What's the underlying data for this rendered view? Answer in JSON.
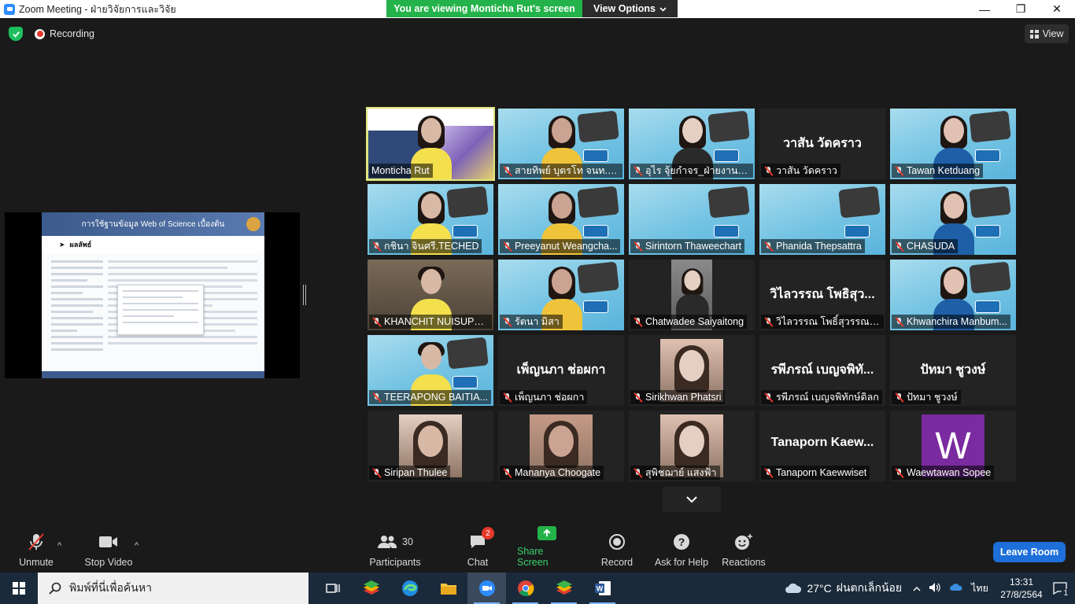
{
  "window": {
    "title": "Zoom Meeting - ฝ่ายวิจัยการและวิจัย",
    "minimize": "—",
    "maximize": "❐",
    "close": "✕"
  },
  "banner": {
    "viewing": "You are viewing Monticha Rut's screen",
    "view_options": "View Options",
    "chevron": "⌄"
  },
  "status": {
    "recording": "Recording",
    "view": "View"
  },
  "slide": {
    "header": "การใช้ฐานข้อมูล Web of Science เบื้องต้น",
    "subtitle": "ผลลัพธ์"
  },
  "participants": [
    {
      "name": "Monticha Rut",
      "display": "",
      "kind": "photo-rutt"
    },
    {
      "name": "สายทิพย์  บุตรโท  จนท.ปร...",
      "display": "",
      "kind": "ppt"
    },
    {
      "name": "อุไร จุ้ยกำจร_ฝ่ายงานประ...",
      "display": "",
      "kind": "ppt"
    },
    {
      "name": "วาสัน  วัดคราว",
      "display": "วาสัน  วัดคราว",
      "kind": "name"
    },
    {
      "name": "Tawan Ketduang",
      "display": "",
      "kind": "ppt"
    },
    {
      "name": "กชินา  จินศรี.TECHED",
      "display": "",
      "kind": "ppt"
    },
    {
      "name": "Preeyanut Weangcha...",
      "display": "",
      "kind": "ppt"
    },
    {
      "name": "Sirintorn Thaweechart",
      "display": "",
      "kind": "ppt-empty"
    },
    {
      "name": "Phanida Thepsattra",
      "display": "",
      "kind": "ppt-empty"
    },
    {
      "name": "CHASUDA",
      "display": "",
      "kind": "ppt"
    },
    {
      "name": "KHANCHIT NUISUPHAP",
      "display": "",
      "kind": "cam-man"
    },
    {
      "name": "รัตนา  มิสา",
      "display": "",
      "kind": "ppt"
    },
    {
      "name": "Chatwadee Saiyaitong",
      "display": "",
      "kind": "cam-portrait"
    },
    {
      "name": "วิไลวรรณ  โพธิ์สุวรรณพร",
      "display": "วิไลวรรณ  โพธิสุว...",
      "kind": "name"
    },
    {
      "name": "Khwanchira Manbum...",
      "display": "",
      "kind": "ppt"
    },
    {
      "name": "TEERAPONG  BAITIA...",
      "display": "",
      "kind": "ppt-man"
    },
    {
      "name": "เพ็ญนภา  ช่อผกา",
      "display": "เพ็ญนภา  ช่อผกา",
      "kind": "name"
    },
    {
      "name": "Sirikhwan Phatsri",
      "display": "",
      "kind": "photo"
    },
    {
      "name": "รพีภรณ์  เบญจพิทักษ์ดิลก",
      "display": "รพีภรณ์  เบญจพิทั...",
      "kind": "name"
    },
    {
      "name": "ปัทมา  ชูวงษ์",
      "display": "ปัทมา  ชูวงษ์",
      "kind": "name"
    },
    {
      "name": "Siripan Thulee",
      "display": "",
      "kind": "photo"
    },
    {
      "name": "Mananya Choogate",
      "display": "",
      "kind": "photo"
    },
    {
      "name": "สุพิชฌาย์ แสงฟ้า",
      "display": "",
      "kind": "photo"
    },
    {
      "name": "Tanaporn Kaewwiset",
      "display": "Tanaporn  Kaew...",
      "kind": "name"
    },
    {
      "name": "Waewtawan Sopee",
      "display": "",
      "kind": "letter",
      "letter": "W"
    }
  ],
  "toolbar": {
    "unmute": "Unmute",
    "stop_video": "Stop Video",
    "participants": "Participants",
    "participants_count": "30",
    "chat": "Chat",
    "chat_badge": "2",
    "share_screen": "Share Screen",
    "record": "Record",
    "ask_help": "Ask for Help",
    "reactions": "Reactions",
    "leave": "Leave Room",
    "caret": "^"
  },
  "taskbar": {
    "search_placeholder": "พิมพ์ที่นี่เพื่อค้นหา",
    "temperature": "27°C",
    "weather": "ฝนตกเล็กน้อย",
    "language": "ไทย",
    "time": "13:31",
    "date": "27/8/2564",
    "notifications": "1"
  },
  "colors": {
    "accent_green": "#24b34a",
    "leave_blue": "#1e6fd9",
    "mute_red": "#e8392a",
    "active_outline": "#dde57a"
  }
}
